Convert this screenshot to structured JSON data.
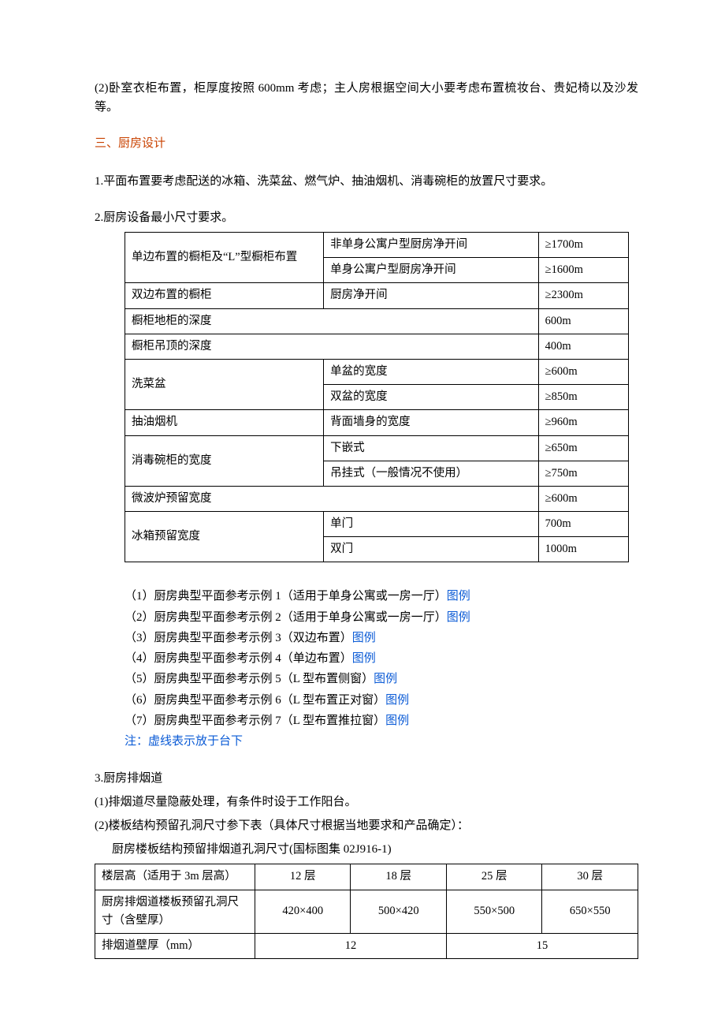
{
  "intro": "(2)卧室衣柜布置，柜厚度按照 600mm 考虑；主人房根据空间大小要考虑布置梳妆台、贵妃椅以及沙发等。",
  "heading3": "三、厨房设计",
  "p1": "1.平面布置要考虑配送的冰箱、洗菜盆、燃气炉、抽油烟机、消毒碗柜的放置尺寸要求。",
  "p2": "2.厨房设备最小尺寸要求。",
  "table1": {
    "r1c1": "单边布置的橱柜及“L”型橱柜布置",
    "r1c2": "非单身公寓户型厨房净开间",
    "r1c3": "≥1700m",
    "r2c2": "单身公寓户型厨房净开间",
    "r2c3": "≥1600m",
    "r3c1": "双边布置的橱柜",
    "r3c2": "厨房净开间",
    "r3c3": "≥2300m",
    "r4c1": "橱柜地柜的深度",
    "r4c3": "600m",
    "r5c1": "橱柜吊顶的深度",
    "r5c3": "400m",
    "r6c1": "洗菜盆",
    "r6c2": "单盆的宽度",
    "r6c3": "≥600m",
    "r7c2": "双盆的宽度",
    "r7c3": "≥850m",
    "r8c1": "抽油烟机",
    "r8c2": "背面墙身的宽度",
    "r8c3": "≥960m",
    "r9c1": "消毒碗柜的宽度",
    "r9c2": "下嵌式",
    "r9c3": "≥650m",
    "r10c2": "吊挂式（一般情况不使用）",
    "r10c3": "≥750m",
    "r11c1": "微波炉预留宽度",
    "r11c3": "≥600m",
    "r12c1": "冰箱预留宽度",
    "r12c2": "单门",
    "r12c3": "700m",
    "r13c2": "双门",
    "r13c3": "1000m"
  },
  "examples": {
    "e1t": "（1）厨房典型平面参考示例 1（适用于单身公寓或一房一厅）",
    "e2t": "（2）厨房典型平面参考示例 2（适用于单身公寓或一房一厅）",
    "e3t": "（3）厨房典型平面参考示例 3（双边布置）",
    "e4t": "（4）厨房典型平面参考示例 4（单边布置）",
    "e5t": "（5）厨房典型平面参考示例 5（L 型布置侧窗）",
    "e6t": "（6）厨房典型平面参考示例 6（L 型布置正对窗）",
    "e7t": "（7）厨房典型平面参考示例 7（L 型布置推拉窗）",
    "link": "图例",
    "note": "注：虚线表示放于台下"
  },
  "p3": "3.厨房排烟道",
  "p3a": "(1)排烟道尽量隐蔽处理，有条件时设于工作阳台。",
  "p3b": "(2)楼板结构预留孔洞尺寸参下表（具体尺寸根据当地要求和产品确定）：",
  "p3c": "厨房楼板结构预留排烟道孔洞尺寸(国标图集 02J916-1)",
  "table2": {
    "h1": "楼层高（适用于 3m 层高）",
    "h2": "12 层",
    "h3": "18 层",
    "h4": "25 层",
    "h5": "30 层",
    "r2c1": "厨房排烟道楼板预留孔洞尺寸（含壁厚）",
    "r2c2": "420×400",
    "r2c3": "500×420",
    "r2c4": "550×500",
    "r2c5": "650×550",
    "r3c1": "排烟道壁厚（mm）",
    "r3c2": "12",
    "r3c3": "15"
  }
}
